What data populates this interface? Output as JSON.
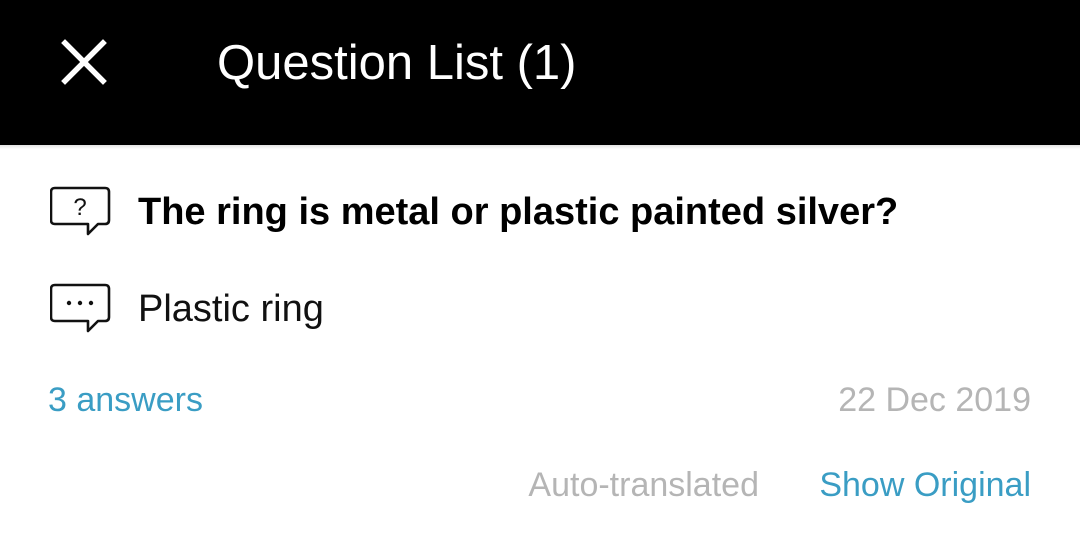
{
  "header": {
    "close_icon": "close-icon",
    "title": "Question List (1)",
    "background": "#000000"
  },
  "question": {
    "icon": "question-bubble-icon",
    "text": "The ring is metal or plastic painted silver?"
  },
  "answer": {
    "icon": "answer-bubble-icon",
    "text": "Plastic ring"
  },
  "footer": {
    "answers_link": "3 answers",
    "date": "22 Dec 2019",
    "auto_translated": "Auto-translated",
    "show_original": "Show Original"
  },
  "colors": {
    "accent": "#3a9dc4",
    "muted": "#b5b5b5"
  }
}
